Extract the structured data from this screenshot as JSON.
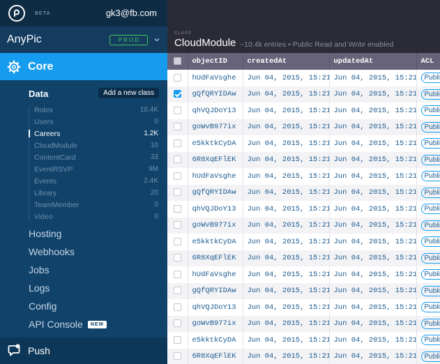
{
  "topbar": {
    "beta_label": "BETA",
    "user_email": "gk3@fb.com"
  },
  "app": {
    "name": "AnyPic",
    "env_badge": "PROD"
  },
  "core": {
    "label": "Core"
  },
  "data_section": {
    "label": "Data",
    "add_class_label": "Add a new class",
    "classes": [
      {
        "name": "Roles",
        "count": "10.4K"
      },
      {
        "name": "Users",
        "count": "0"
      },
      {
        "name": "Careers",
        "count": "1.2K"
      },
      {
        "name": "CloudModule",
        "count": "10"
      },
      {
        "name": "ContentCard",
        "count": "33"
      },
      {
        "name": "EventRSVP",
        "count": "9M"
      },
      {
        "name": "Events",
        "count": "2.4K"
      },
      {
        "name": "Library",
        "count": "20"
      },
      {
        "name": "TeamMember",
        "count": "0"
      },
      {
        "name": "Video",
        "count": "0"
      }
    ],
    "active_index": 2
  },
  "nav": {
    "hosting": "Hosting",
    "webhooks": "Webhooks",
    "jobs": "Jobs",
    "logs": "Logs",
    "config": "Config",
    "api_console": "API Console",
    "new_badge": "NEW",
    "push": "Push"
  },
  "class_header": {
    "kicker": "CLASS",
    "title": "CloudModule",
    "meta": "~10.4k entries • Public Read and Write enabled"
  },
  "table": {
    "columns": [
      "objectID",
      "createdAt",
      "updatedAt",
      "ACL"
    ],
    "rows": [
      {
        "objectId": "hUdFaVsghe",
        "createdAt": "Jun 04, 2015, 15:21",
        "updatedAt": "Jun 04, 2015, 15:21",
        "acl": "Public",
        "checked": false
      },
      {
        "objectId": "gQfQRYIDAw",
        "createdAt": "Jun 04, 2015, 15:21",
        "updatedAt": "Jun 04, 2015, 15:21",
        "acl": "Public",
        "checked": true
      },
      {
        "objectId": "qhVQJDoY13",
        "createdAt": "Jun 04, 2015, 15:21",
        "updatedAt": "Jun 04, 2015, 15:21",
        "acl": "Public",
        "checked": false
      },
      {
        "objectId": "goWvB977ix",
        "createdAt": "Jun 04, 2015, 15:21",
        "updatedAt": "Jun 04, 2015, 15:21",
        "acl": "Public",
        "checked": false
      },
      {
        "objectId": "e5kktkCyDA",
        "createdAt": "Jun 04, 2015, 15:21",
        "updatedAt": "Jun 04, 2015, 15:21",
        "acl": "Public",
        "checked": false
      },
      {
        "objectId": "6R8XqEFlEK",
        "createdAt": "Jun 04, 2015, 15:21",
        "updatedAt": "Jun 04, 2015, 15:21",
        "acl": "Public",
        "checked": false
      },
      {
        "objectId": "hUdFaVsghe",
        "createdAt": "Jun 04, 2015, 15:21",
        "updatedAt": "Jun 04, 2015, 15:21",
        "acl": "Public",
        "checked": false
      },
      {
        "objectId": "gQfQRYIDAw",
        "createdAt": "Jun 04, 2015, 15:21",
        "updatedAt": "Jun 04, 2015, 15:21",
        "acl": "Public",
        "checked": false
      },
      {
        "objectId": "qhVQJDoY13",
        "createdAt": "Jun 04, 2015, 15:21",
        "updatedAt": "Jun 04, 2015, 15:21",
        "acl": "Public",
        "checked": false
      },
      {
        "objectId": "goWvB977ix",
        "createdAt": "Jun 04, 2015, 15:21",
        "updatedAt": "Jun 04, 2015, 15:21",
        "acl": "Public",
        "checked": false
      },
      {
        "objectId": "e5kktkCyDA",
        "createdAt": "Jun 04, 2015, 15:21",
        "updatedAt": "Jun 04, 2015, 15:21",
        "acl": "Public",
        "checked": false
      },
      {
        "objectId": "6R8XqEFlEK",
        "createdAt": "Jun 04, 2015, 15:21",
        "updatedAt": "Jun 04, 2015, 15:21",
        "acl": "Public",
        "checked": false
      },
      {
        "objectId": "hUdFaVsghe",
        "createdAt": "Jun 04, 2015, 15:21",
        "updatedAt": "Jun 04, 2015, 15:21",
        "acl": "Public",
        "checked": false
      },
      {
        "objectId": "gQfQRYIDAw",
        "createdAt": "Jun 04, 2015, 15:21",
        "updatedAt": "Jun 04, 2015, 15:21",
        "acl": "Public",
        "checked": false
      },
      {
        "objectId": "qhVQJDoY13",
        "createdAt": "Jun 04, 2015, 15:21",
        "updatedAt": "Jun 04, 2015, 15:21",
        "acl": "Public",
        "checked": false
      },
      {
        "objectId": "goWvB977ix",
        "createdAt": "Jun 04, 2015, 15:21",
        "updatedAt": "Jun 04, 2015, 15:21",
        "acl": "Public",
        "checked": false
      },
      {
        "objectId": "e5kktkCyDA",
        "createdAt": "Jun 04, 2015, 15:21",
        "updatedAt": "Jun 04, 2015, 15:21",
        "acl": "Public",
        "checked": false
      },
      {
        "objectId": "6R8XqEFlEK",
        "createdAt": "Jun 04, 2015, 15:21",
        "updatedAt": "Jun 04, 2015, 15:21",
        "acl": "Public",
        "checked": false
      }
    ]
  },
  "colors": {
    "sidebar_bg": "#10426a",
    "topbar_bg": "#0f2c45",
    "accent": "#169cee",
    "prod_green": "#47c75a",
    "header_bg": "#2b2b36",
    "table_head_bg": "#66637a"
  },
  "icons": {
    "logo": "parse-logo-icon",
    "core": "gear-icon",
    "push": "chat-bubble-icon",
    "app_switch": "chevron-down-icon"
  }
}
